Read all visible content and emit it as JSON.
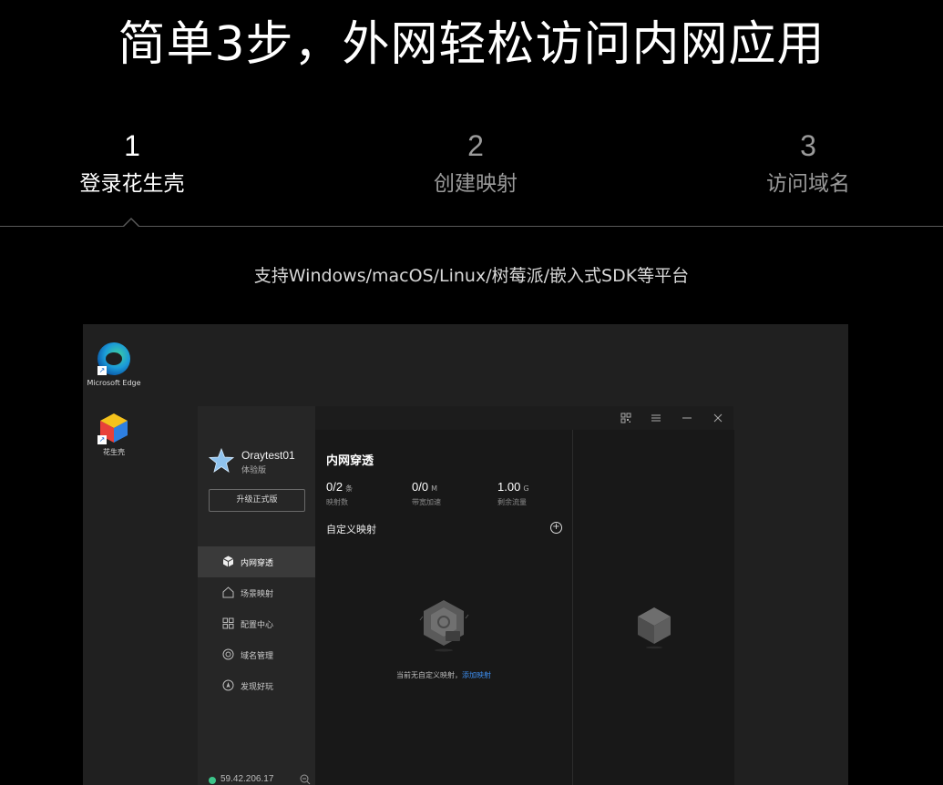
{
  "hero": {
    "title": "简单3步，外网轻松访问内网应用"
  },
  "steps": [
    {
      "num": "1",
      "label": "登录花生壳",
      "active": true
    },
    {
      "num": "2",
      "label": "创建映射",
      "active": false
    },
    {
      "num": "3",
      "label": "访问域名",
      "active": false
    }
  ],
  "subtitle": "支持Windows/macOS/Linux/树莓派/嵌入式SDK等平台",
  "desktop": {
    "icons": [
      {
        "label": "Microsoft Edge",
        "icon": "edge-icon"
      },
      {
        "label": "花生壳",
        "icon": "oray-cube-icon"
      }
    ]
  },
  "app": {
    "user": {
      "name": "Oraytest01",
      "plan": "体验版"
    },
    "upgrade_label": "升级正式版",
    "nav": [
      {
        "label": "内网穿透",
        "icon": "cube-icon",
        "active": true
      },
      {
        "label": "场景映射",
        "icon": "house-icon",
        "active": false
      },
      {
        "label": "配置中心",
        "icon": "grid-icon",
        "active": false
      },
      {
        "label": "域名管理",
        "icon": "globe-icon",
        "active": false
      },
      {
        "label": "发现好玩",
        "icon": "compass-icon",
        "active": false
      }
    ],
    "ip": "59.42.206.17",
    "main": {
      "title": "内网穿透",
      "stats": [
        {
          "value": "0/2",
          "unit": "条",
          "label": "映射数"
        },
        {
          "value": "0/0",
          "unit": "M",
          "label": "带宽加速"
        },
        {
          "value": "1.00",
          "unit": "G",
          "label": "剩余流量"
        }
      ],
      "custom_title": "自定义映射",
      "add_symbol": "+",
      "empty_text": "当前无自定义映射，",
      "empty_link": "添加映射"
    }
  },
  "colors": {
    "accent_link": "#3d8ef0",
    "status_green": "#3cc58a",
    "active_tab_bar": "#e07a1f"
  }
}
